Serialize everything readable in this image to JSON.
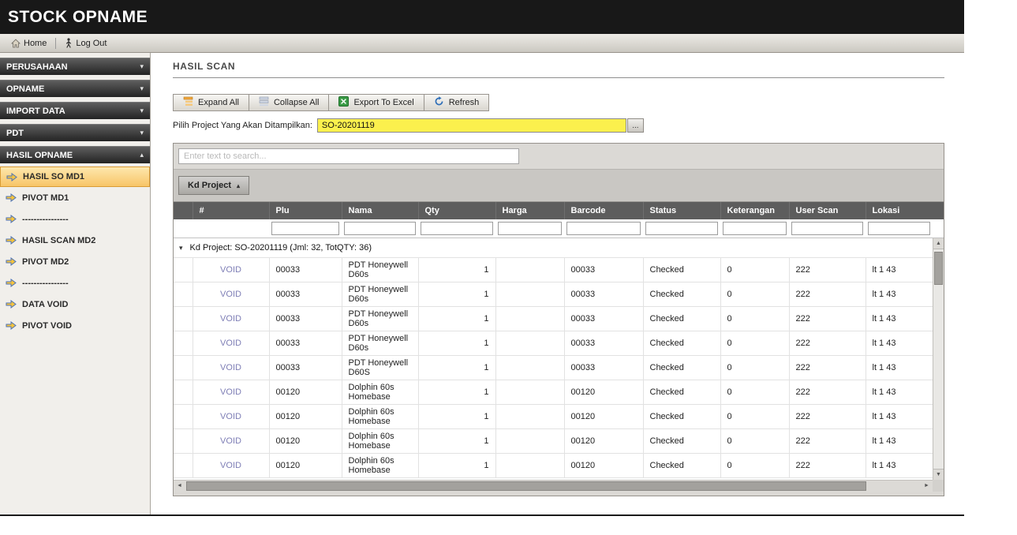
{
  "header": {
    "title": "STOCK OPNAME"
  },
  "topbar": {
    "home_label": "Home",
    "logout_label": "Log Out"
  },
  "icons": {
    "chevron_down": "▾",
    "chevron_up": "▴",
    "sort_up": "▴",
    "group_expanded": "▾",
    "scroll_up": "▲",
    "scroll_down": "▼",
    "scroll_left": "◄",
    "scroll_right": "►"
  },
  "sidebar": {
    "groups": [
      {
        "label": "PERUSAHAAN",
        "expanded": false
      },
      {
        "label": "OPNAME",
        "expanded": false
      },
      {
        "label": "IMPORT DATA",
        "expanded": false
      },
      {
        "label": "PDT",
        "expanded": false
      },
      {
        "label": "HASIL OPNAME",
        "expanded": true
      }
    ],
    "items": [
      {
        "label": "HASIL SO MD1",
        "selected": true
      },
      {
        "label": "PIVOT MD1",
        "selected": false
      },
      {
        "label": "----------------",
        "selected": false
      },
      {
        "label": "HASIL SCAN MD2",
        "selected": false
      },
      {
        "label": "PIVOT MD2",
        "selected": false
      },
      {
        "label": "----------------",
        "selected": false
      },
      {
        "label": "DATA VOID",
        "selected": false
      },
      {
        "label": "PIVOT VOID",
        "selected": false
      }
    ]
  },
  "main": {
    "title": "HASIL SCAN",
    "toolbar": {
      "expand_all": "Expand All",
      "collapse_all": "Collapse All",
      "export_excel": "Export To Excel",
      "refresh": "Refresh"
    },
    "project_picker": {
      "label": "Pilih Project Yang Akan Ditampilkan:",
      "value": "SO-20201119",
      "browse_label": "..."
    },
    "grid": {
      "search_placeholder": "Enter text to search...",
      "group_button_label": "Kd Project",
      "columns": [
        "#",
        "Plu",
        "Nama",
        "Qty",
        "Harga",
        "Barcode",
        "Status",
        "Keterangan",
        "User Scan",
        "Lokasi"
      ],
      "group_row_label": "Kd Project: SO-20201119 (Jml: 32, TotQTY: 36)",
      "rows": [
        {
          "cmd": "VOID",
          "plu": "00033",
          "nama": "PDT Honeywell D60s",
          "qty": "1",
          "harga": "",
          "barcode": "00033",
          "status": "Checked",
          "keterangan": "0",
          "user_scan": "222",
          "lokasi": "lt 1 43"
        },
        {
          "cmd": "VOID",
          "plu": "00033",
          "nama": "PDT Honeywell D60s",
          "qty": "1",
          "harga": "",
          "barcode": "00033",
          "status": "Checked",
          "keterangan": "0",
          "user_scan": "222",
          "lokasi": "lt 1 43"
        },
        {
          "cmd": "VOID",
          "plu": "00033",
          "nama": "PDT Honeywell D60s",
          "qty": "1",
          "harga": "",
          "barcode": "00033",
          "status": "Checked",
          "keterangan": "0",
          "user_scan": "222",
          "lokasi": "lt 1 43"
        },
        {
          "cmd": "VOID",
          "plu": "00033",
          "nama": "PDT Honeywell D60s",
          "qty": "1",
          "harga": "",
          "barcode": "00033",
          "status": "Checked",
          "keterangan": "0",
          "user_scan": "222",
          "lokasi": "lt 1 43"
        },
        {
          "cmd": "VOID",
          "plu": "00033",
          "nama": "PDT Honeywell D60S",
          "qty": "1",
          "harga": "",
          "barcode": "00033",
          "status": "Checked",
          "keterangan": "0",
          "user_scan": "222",
          "lokasi": "lt 1 43"
        },
        {
          "cmd": "VOID",
          "plu": "00120",
          "nama": "Dolphin 60s Homebase",
          "qty": "1",
          "harga": "",
          "barcode": "00120",
          "status": "Checked",
          "keterangan": "0",
          "user_scan": "222",
          "lokasi": "lt 1 43"
        },
        {
          "cmd": "VOID",
          "plu": "00120",
          "nama": "Dolphin 60s Homebase",
          "qty": "1",
          "harga": "",
          "barcode": "00120",
          "status": "Checked",
          "keterangan": "0",
          "user_scan": "222",
          "lokasi": "lt 1 43"
        },
        {
          "cmd": "VOID",
          "plu": "00120",
          "nama": "Dolphin 60s Homebase",
          "qty": "1",
          "harga": "",
          "barcode": "00120",
          "status": "Checked",
          "keterangan": "0",
          "user_scan": "222",
          "lokasi": "lt 1 43"
        },
        {
          "cmd": "VOID",
          "plu": "00120",
          "nama": "Dolphin 60s Homebase",
          "qty": "1",
          "harga": "",
          "barcode": "00120",
          "status": "Checked",
          "keterangan": "0",
          "user_scan": "222",
          "lokasi": "lt 1 43"
        }
      ]
    }
  },
  "colors": {
    "titlebar_bg": "#181818",
    "selected_item_bg": "#f8c568",
    "project_field_bg": "#fbf04d",
    "grid_header_bg": "#5d5d5d",
    "void_link": "#7d7db5"
  }
}
